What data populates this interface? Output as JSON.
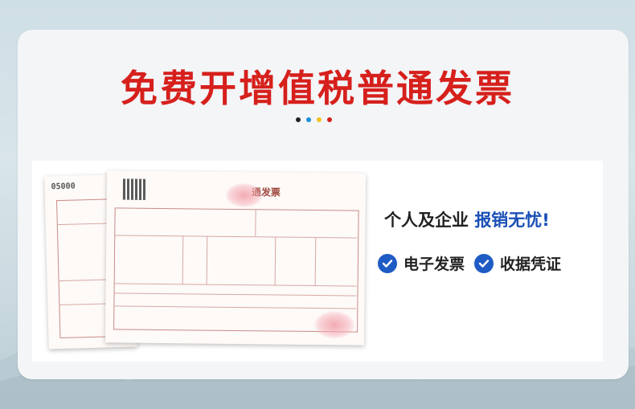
{
  "header": {
    "title": "免费开增值税普通发票",
    "dot_colors": [
      "#222222",
      "#1a8fd6",
      "#f2c21b",
      "#d6201c"
    ]
  },
  "invoice": {
    "back_number": "05000",
    "front_title": "通发票"
  },
  "right_panel": {
    "slogan_prefix": "个人及企业",
    "slogan_highlight": "报销无忧!",
    "features": [
      {
        "icon": "check-circle-icon",
        "label": "电子发票"
      },
      {
        "icon": "check-circle-icon",
        "label": "收据凭证"
      }
    ]
  },
  "colors": {
    "title_red": "#d6201c",
    "accent_blue": "#1a4fb6"
  }
}
